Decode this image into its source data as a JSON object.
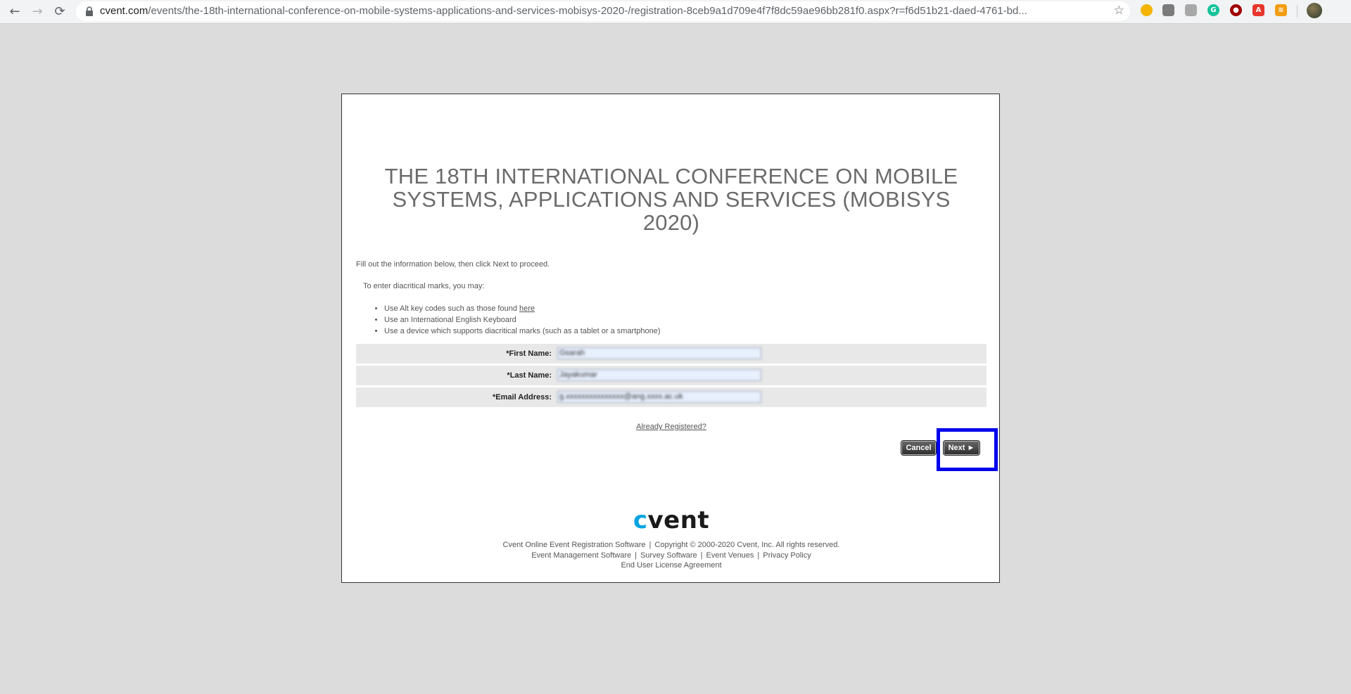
{
  "browser": {
    "url_host": "cvent.com",
    "url_path": "/events/the-18th-international-conference-on-mobile-systems-applications-and-services-mobisys-2020-/registration-8ceb9a1d709e4f7f8dc59ae96bb281f0.aspx?r=f6d51b21-daed-4761-bd...",
    "back_icon": "←",
    "forward_icon": "→",
    "reload_icon": "⟳",
    "star_icon": "☆",
    "extensions": [
      {
        "name": "chrome-ext-icon-1",
        "color": "#f4b400"
      },
      {
        "name": "chrome-ext-icon-2",
        "color": "#7b7b7b"
      },
      {
        "name": "chrome-ext-icon-3",
        "color": "#a8a8a8"
      },
      {
        "name": "grammarly-icon",
        "color": "#15c39a"
      },
      {
        "name": "ublock-icon",
        "color": "#a00000"
      },
      {
        "name": "adobe-icon",
        "color": "#e8362c"
      },
      {
        "name": "rss-icon",
        "color": "#f39c12"
      }
    ]
  },
  "event": {
    "title": "THE 18TH INTERNATIONAL CONFERENCE ON MOBILE SYSTEMS, APPLICATIONS AND SERVICES (MOBISYS 2020)"
  },
  "instructions": {
    "intro": "Fill out the information below, then click Next to proceed.",
    "diacritical": "To enter diacritical marks, you may:",
    "bullet1_prefix": "Use Alt key codes such as those found ",
    "bullet1_link": "here",
    "bullet2": "Use an International English Keyboard",
    "bullet3": "Use a device which supports diacritical marks (such as a tablet or a smartphone)"
  },
  "form": {
    "first_name_label": "*First Name:",
    "first_name_value": "Gsarah",
    "last_name_label": "*Last Name:",
    "last_name_value": "Jayakumar",
    "email_label": "*Email Address:",
    "email_value": "g.xxxxxxxxxxxxxxx@ang.xxxx.ac.uk"
  },
  "links": {
    "already_registered": "Already Registered?"
  },
  "buttons": {
    "cancel": "Cancel",
    "next": "Next ►"
  },
  "footer": {
    "logo_c": "c",
    "logo_rest": "vent",
    "line1_a": "Cvent Online Event Registration Software",
    "line1_b": "Copyright © 2000-2020 Cvent, Inc. All rights reserved.",
    "line2_a": "Event Management Software",
    "line2_b": "Survey Software",
    "line2_c": "Event Venues",
    "line2_d": "Privacy Policy",
    "line3": "End User License Agreement",
    "separator": "|"
  },
  "colors": {
    "highlight": "#0000ee",
    "brand_cyan": "#00a3e0"
  }
}
